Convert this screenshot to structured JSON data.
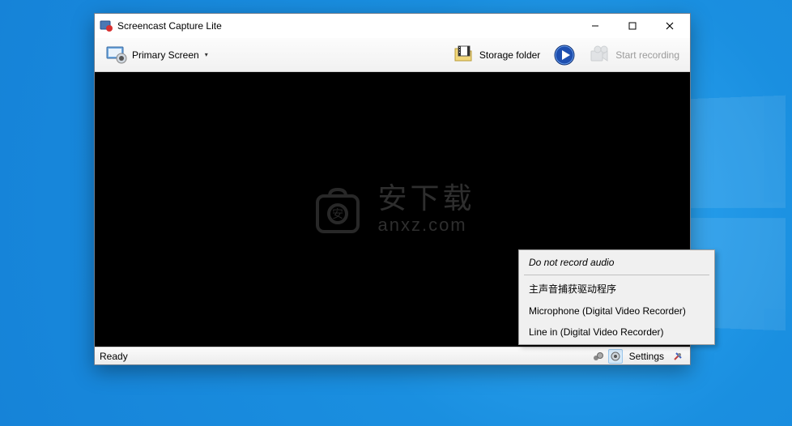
{
  "titlebar": {
    "title": "Screencast Capture Lite"
  },
  "toolbar": {
    "primary_screen": "Primary Screen",
    "storage_folder": "Storage folder",
    "start_recording": "Start recording"
  },
  "watermark": {
    "line1": "安下载",
    "line2": "anxz.com"
  },
  "statusbar": {
    "ready": "Ready",
    "settings": "Settings"
  },
  "context_menu": {
    "items": [
      "Do not record audio",
      "主声音捕获驱动程序",
      "Microphone (Digital Video Recorder)",
      "Line in (Digital Video Recorder)"
    ]
  }
}
